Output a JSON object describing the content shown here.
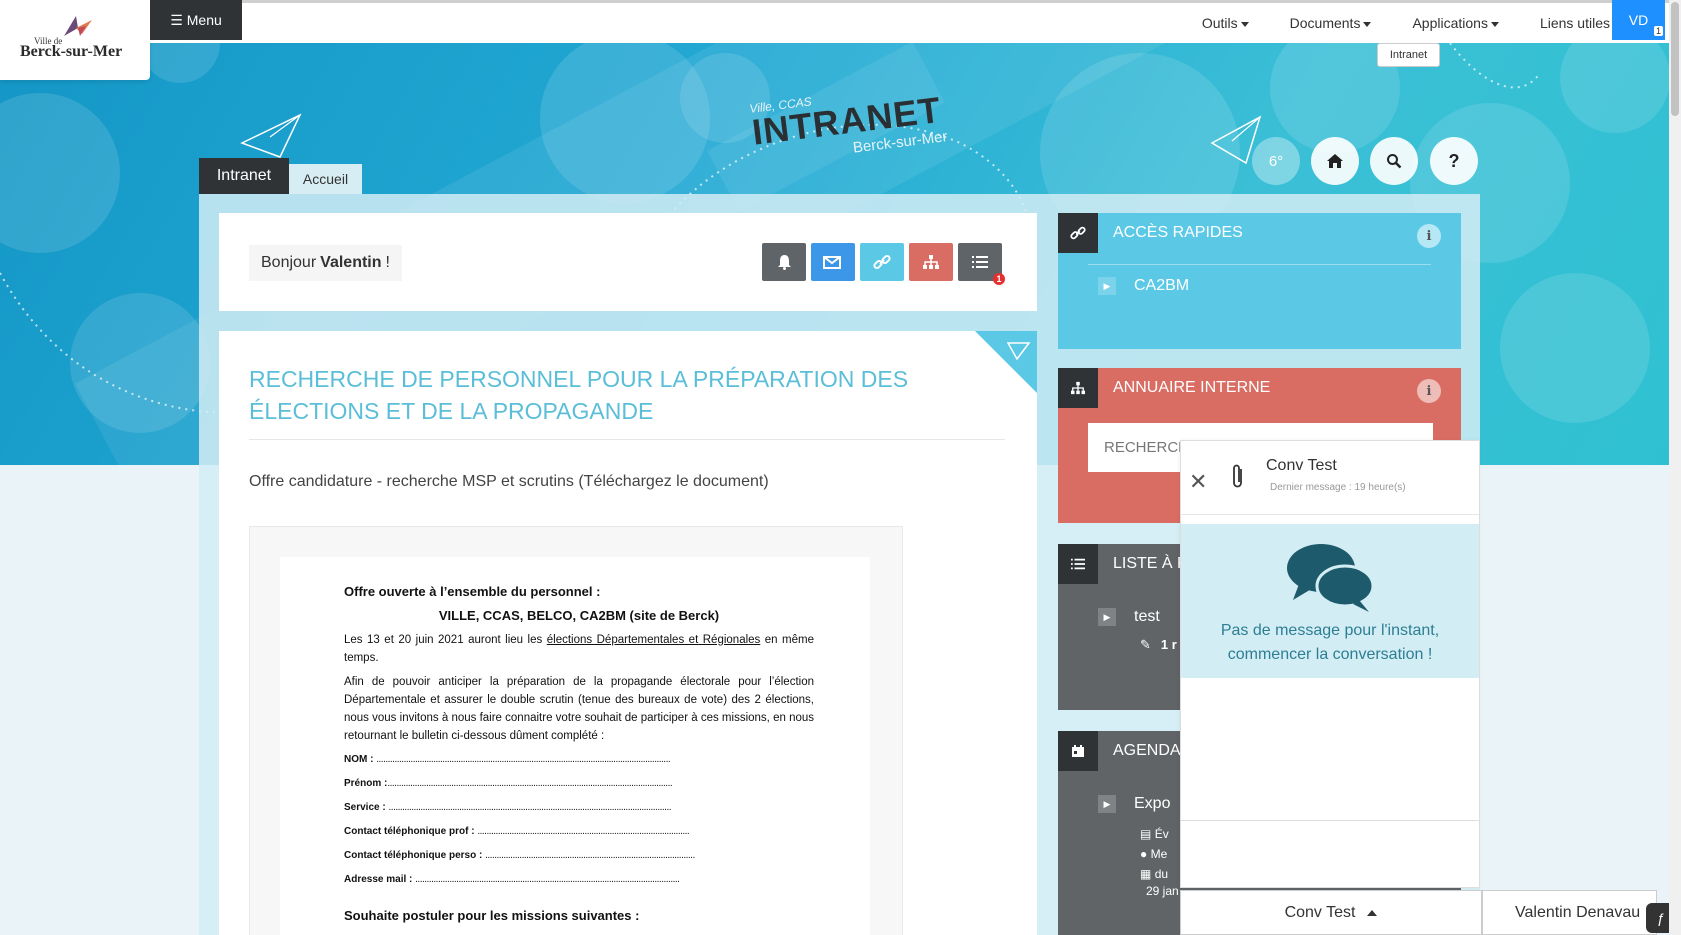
{
  "header": {
    "logo_ville": "Ville de",
    "logo_name": "Berck-sur-Mer",
    "menu_label": "Menu",
    "nav": [
      "Outils",
      "Documents",
      "Applications",
      "Liens utiles"
    ],
    "user_initials": "VD",
    "user_badge": "1",
    "tooltip": "Intranet"
  },
  "banner": {
    "small": "Ville, CCAS",
    "title": "INTRANET",
    "subtitle": "Berck-sur-Mer",
    "temperature": "6°"
  },
  "tabs": [
    "Intranet",
    "Accueil"
  ],
  "greeting": {
    "hello": "Bonjour",
    "name": "Valentin",
    "suffix": "!",
    "badge": "1"
  },
  "article": {
    "title": "RECHERCHE DE PERSONNEL POUR LA PRÉPARATION DES ÉLECTIONS ET DE LA PROPAGANDE",
    "subtitle": "Offre candidature - recherche MSP et scrutins (Téléchargez le document)",
    "doc": {
      "heading": "Offre ouverte à l’ensemble du personnel :",
      "center": "VILLE, CCAS, BELCO, CA2BM (site de Berck)",
      "p1_before": "Les 13 et 20 juin 2021 auront lieu les ",
      "p1_link": "élections Départementales et Régionales",
      "p1_after": " en même temps.",
      "p2": "Afin de pouvoir anticiper la préparation de la propagande électorale pour l’élection Départementale et assurer le double scrutin (tenue des bureaux de vote) des 2 élections, nous vous invitons à nous faire connaitre votre souhait de participer à ces missions, en nous retournant le bulletin ci-dessous dûment complété :",
      "fields": [
        "NOM :",
        "Prénom :",
        "Service :",
        "Contact téléphonique prof :",
        "Contact téléphonique perso :",
        "Adresse mail :"
      ],
      "footer": "Souhaite postuler pour les missions suivantes :"
    }
  },
  "widgets": {
    "acces": {
      "title": "ACCÈS RAPIDES",
      "items": [
        "CA2BM"
      ]
    },
    "annuaire": {
      "title": "ANNUAIRE INTERNE",
      "placeholder": "RECHERCH"
    },
    "liste": {
      "title": "LISTE À FA",
      "item": "test",
      "meta": "1 r"
    },
    "agenda": {
      "title": "AGENDA",
      "item": "Expo",
      "l1": "Év",
      "l2": "Me",
      "l3": "du",
      "date": "29 jan"
    }
  },
  "chat": {
    "name": "Conv Test",
    "last": "Dernier message : 19 heure(s)",
    "empty_line1": "Pas de message pour l'instant,",
    "empty_line2": "commencer la conversation !",
    "tab1": "Conv Test",
    "tab2": "Valentin Denavau"
  },
  "colors": {
    "acces": "#5bc9e6",
    "annuaire": "#d96d63",
    "liste": "#606467",
    "agenda": "#606467",
    "accent": "#5bbed8"
  }
}
